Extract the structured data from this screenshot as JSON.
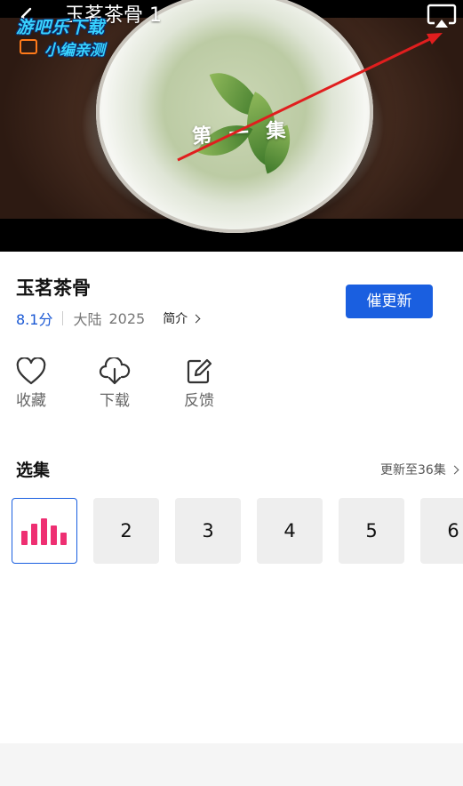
{
  "player": {
    "video_title": "玉茗茶骨 1",
    "episode_caption": "第 一 集",
    "watermark_line1": "游吧乐下载",
    "watermark_line2": "小编亲测",
    "icons": [
      "back-arrow-icon",
      "cast-icon"
    ]
  },
  "show": {
    "title": "玉茗茶骨",
    "rating": "8.1分",
    "region": "大陆",
    "year": "2025",
    "intro_label": "简介",
    "update_button": "催更新"
  },
  "actions": [
    {
      "label": "收藏",
      "icon": "heart-icon"
    },
    {
      "label": "下载",
      "icon": "cloud-download-icon"
    },
    {
      "label": "反馈",
      "icon": "edit-feedback-icon"
    }
  ],
  "episodes": {
    "section_title": "选集",
    "update_status": "更新至36集",
    "items": [
      "2",
      "3",
      "4",
      "5",
      "6"
    ],
    "playing_indicator": "equalizer-icon"
  },
  "colors": {
    "accent_blue": "#1a5fe0",
    "playing_pink": "#ee2f72",
    "annotation_red": "#e01e1e"
  }
}
